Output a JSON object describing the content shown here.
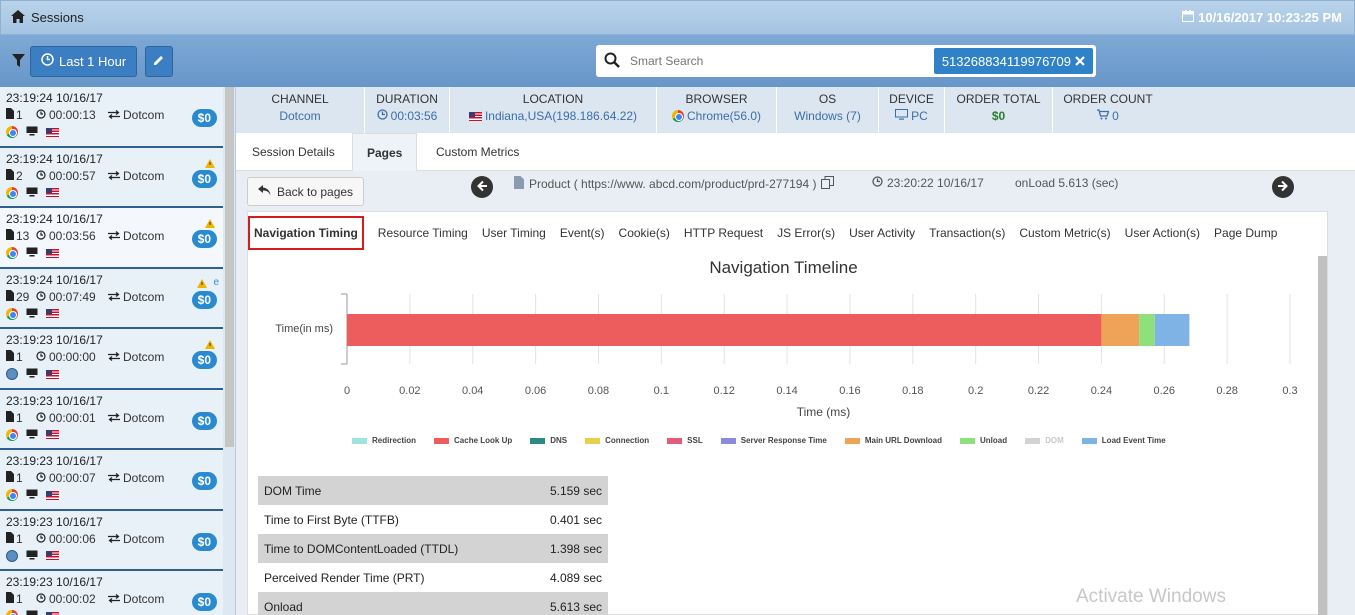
{
  "title": "Sessions",
  "datetime": "10/16/2017 10:23:25 PM",
  "toolbar": {
    "time_label": "Last 1 Hour"
  },
  "search": {
    "placeholder": "Smart Search",
    "tag": "513268834119976709"
  },
  "sessions": [
    {
      "ts": "23:19:24 10/16/17",
      "count": "1",
      "duration": "00:00:13",
      "channel": "Dotcom",
      "amount": "$0",
      "browser": "chrome",
      "warn": false
    },
    {
      "ts": "23:19:24 10/16/17",
      "count": "2",
      "duration": "00:00:57",
      "channel": "Dotcom",
      "amount": "$0",
      "browser": "chrome",
      "warn": true
    },
    {
      "ts": "23:19:24 10/16/17",
      "count": "13",
      "duration": "00:03:56",
      "channel": "Dotcom",
      "amount": "$0",
      "browser": "chrome",
      "warn": true
    },
    {
      "ts": "23:19:24 10/16/17",
      "count": "29",
      "duration": "00:07:49",
      "channel": "Dotcom",
      "amount": "$0",
      "browser": "chrome",
      "warn": true
    },
    {
      "ts": "23:19:23 10/16/17",
      "count": "1",
      "duration": "00:00:00",
      "channel": "Dotcom",
      "amount": "$0",
      "browser": "globe",
      "warn": true
    },
    {
      "ts": "23:19:23 10/16/17",
      "count": "1",
      "duration": "00:00:01",
      "channel": "Dotcom",
      "amount": "$0",
      "browser": "chrome",
      "warn": false
    },
    {
      "ts": "23:19:23 10/16/17",
      "count": "1",
      "duration": "00:00:07",
      "channel": "Dotcom",
      "amount": "$0",
      "browser": "chrome",
      "warn": false
    },
    {
      "ts": "23:19:23 10/16/17",
      "count": "1",
      "duration": "00:00:06",
      "channel": "Dotcom",
      "amount": "$0",
      "browser": "globe",
      "warn": false
    },
    {
      "ts": "23:19:23 10/16/17",
      "count": "1",
      "duration": "00:00:02",
      "channel": "Dotcom",
      "amount": "$0",
      "browser": "chrome",
      "warn": false
    }
  ],
  "info": {
    "channel_label": "CHANNEL",
    "channel": "Dotcom",
    "duration_label": "DURATION",
    "duration": "00:03:56",
    "location_label": "LOCATION",
    "location": "Indiana,USA(198.186.64.22)",
    "browser_label": "BROWSER",
    "browser": "Chrome(56.0)",
    "os_label": "OS",
    "os": "Windows (7)",
    "device_label": "DEVICE",
    "device": "PC",
    "order_total_label": "ORDER TOTAL",
    "order_total": "$0",
    "order_count_label": "ORDER COUNT",
    "order_count": "0"
  },
  "tabs": [
    "Session Details",
    "Pages",
    "Custom Metrics"
  ],
  "page": {
    "back_label": "Back to pages",
    "product": "Product ( https://www. abcd.com/product/prd-277194 )",
    "time": "23:20:22 10/16/17",
    "onload": "onLoad 5.613 (sec)"
  },
  "subtabs": [
    "Navigation Timing",
    "Resource Timing",
    "User Timing",
    "Event(s)",
    "Cookie(s)",
    "HTTP Request",
    "JS Error(s)",
    "User Activity",
    "Transaction(s)",
    "Custom Metric(s)",
    "User Action(s)",
    "Page Dump"
  ],
  "chart_data": {
    "type": "bar",
    "orientation": "horizontal",
    "stacked": true,
    "title": "Navigation Timeline",
    "ylabel": "Time(in ms)",
    "xlabel": "Time (ms)",
    "xlim": [
      0,
      0.3
    ],
    "x_ticks": [
      "0",
      "0.02",
      "0.04",
      "0.06",
      "0.08",
      "0.1",
      "0.12",
      "0.14",
      "0.16",
      "0.18",
      "0.2",
      "0.22",
      "0.24",
      "0.26",
      "0.28",
      "0.3"
    ],
    "grid": true,
    "legend_position": "bottom",
    "series": [
      {
        "name": "Redirection",
        "value": 0,
        "color": "#9fe3e0"
      },
      {
        "name": "Cache Look Up",
        "value": 0.24,
        "color": "#ee5d5d"
      },
      {
        "name": "DNS",
        "value": 0,
        "color": "#2b8a86"
      },
      {
        "name": "Connection",
        "value": 0,
        "color": "#e7d14c"
      },
      {
        "name": "SSL",
        "value": 0,
        "color": "#e35b79"
      },
      {
        "name": "Server Response Time",
        "value": 0,
        "color": "#8a8ae0"
      },
      {
        "name": "Main URL Download",
        "value": 0.012,
        "color": "#efa359"
      },
      {
        "name": "Unload",
        "value": 0.005,
        "color": "#8de07a"
      },
      {
        "name": "DOM",
        "value": 0,
        "color": "#d3d3d3"
      },
      {
        "name": "Load Event Time",
        "value": 0.011,
        "color": "#7fb3e6"
      }
    ]
  },
  "metrics": [
    {
      "label": "DOM Time",
      "value": "5.159 sec"
    },
    {
      "label": "Time to First Byte (TTFB)",
      "value": "0.401 sec"
    },
    {
      "label": "Time to DOMContentLoaded (TTDL)",
      "value": "1.398 sec"
    },
    {
      "label": "Perceived Render Time (PRT)",
      "value": "4.089 sec"
    },
    {
      "label": "Onload",
      "value": "5.613 sec"
    }
  ],
  "watermark": "Activate Windows"
}
